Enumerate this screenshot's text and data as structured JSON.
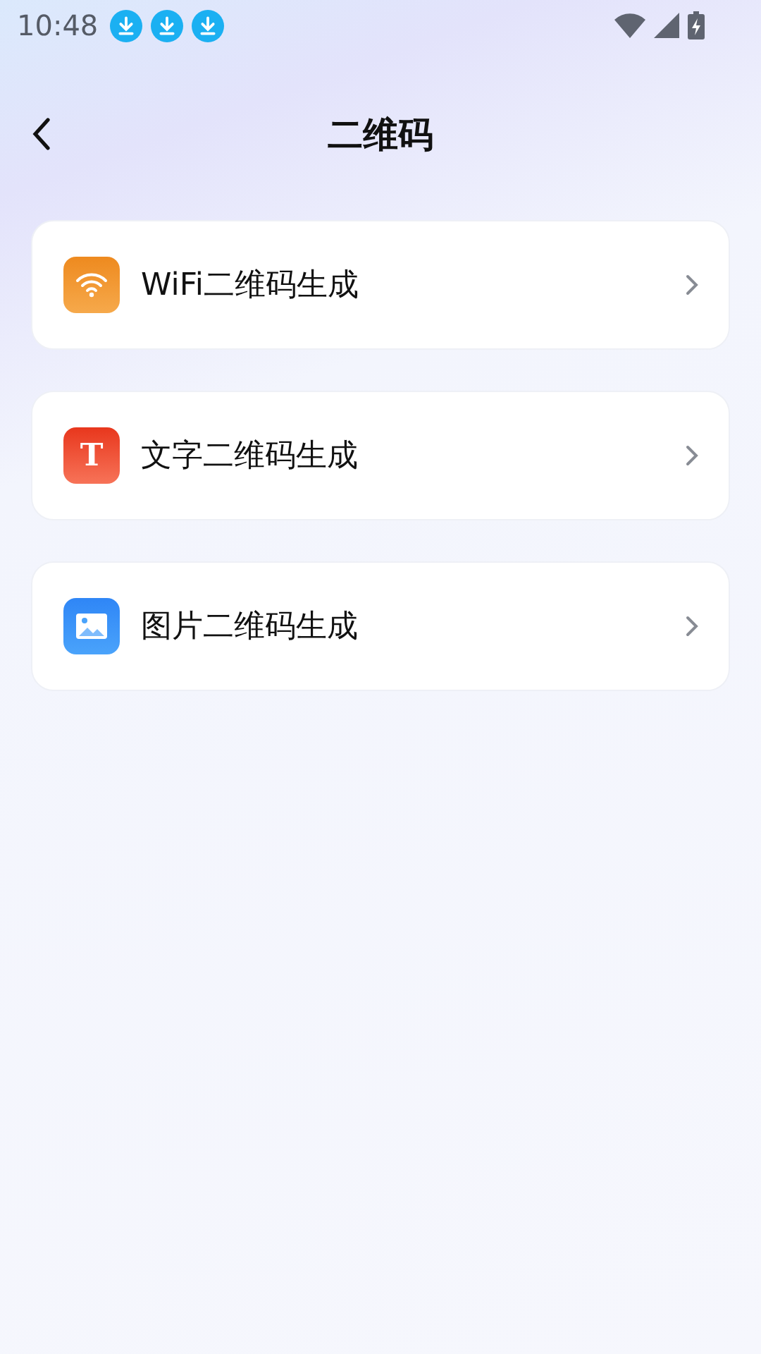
{
  "status_bar": {
    "time": "10:48",
    "notifications": [
      {
        "kind": "download"
      },
      {
        "kind": "download"
      },
      {
        "kind": "download"
      }
    ]
  },
  "header": {
    "title": "二维码"
  },
  "items": [
    {
      "kind": "wifi",
      "label": "WiFi二维码生成"
    },
    {
      "kind": "text",
      "label": "文字二维码生成",
      "icon_text": "T"
    },
    {
      "kind": "image",
      "label": "图片二维码生成"
    }
  ]
}
